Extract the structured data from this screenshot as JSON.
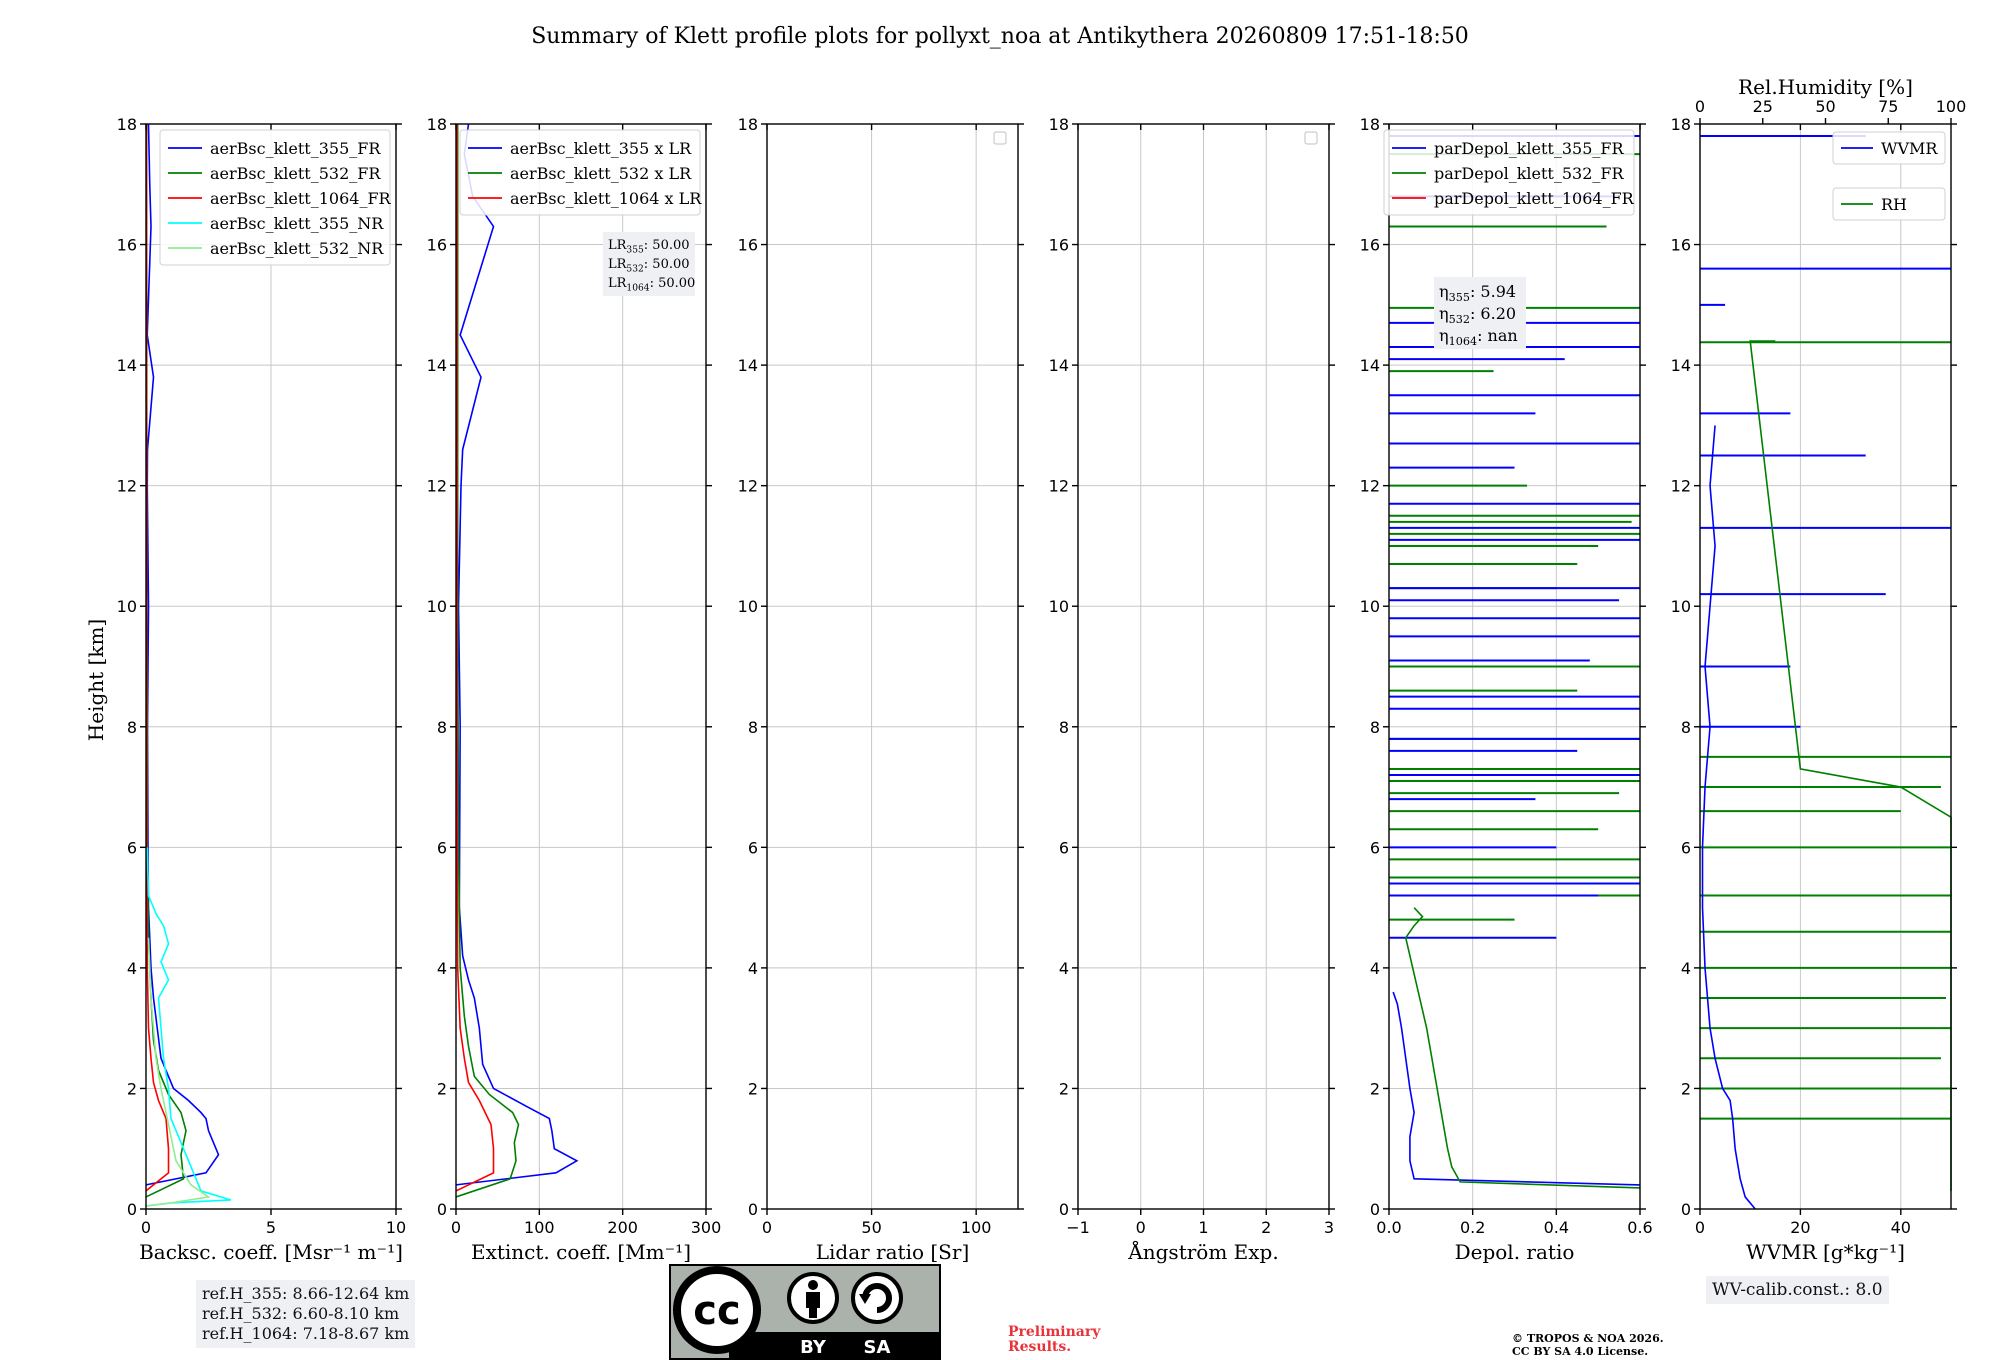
{
  "title": "Summary of Klett profile plots for pollyxt_noa at Antikythera 20260809 17:51-18:50",
  "ylabel": "Height [km]",
  "ref_heights": [
    "ref.H_355: 8.66-12.64 km",
    "ref.H_532: 6.60-8.10 km",
    "ref.H_1064: 7.18-8.67 km"
  ],
  "lidar_ratio_box": [
    {
      "base": "LR",
      "sub": "355",
      "val": ": 50.00"
    },
    {
      "base": "LR",
      "sub": "532",
      "val": ": 50.00"
    },
    {
      "base": "LR",
      "sub": "1064",
      "val": ": 50.00"
    }
  ],
  "eta_box": [
    {
      "base": "η",
      "sub": "355",
      "val": ": 5.94"
    },
    {
      "base": "η",
      "sub": "532",
      "val": ": 6.20"
    },
    {
      "base": "η",
      "sub": "1064",
      "val": ": nan"
    }
  ],
  "wv_calib": "WV-calib.const.: 8.0",
  "preliminary": [
    "Preliminary",
    "Results."
  ],
  "copyright": [
    "© TROPOS & NOA 2026.",
    "CC BY SA 4.0 License."
  ],
  "cc_badge": {
    "main": "cc",
    "by": "BY",
    "sa": "SA",
    "icons": [
      "person-icon",
      "share-alike-icon"
    ]
  },
  "colors": {
    "blue": "#0000ff",
    "green": "#008000",
    "red": "#ff0000",
    "cyan": "#00ffff",
    "lightgreen": "#90ee90",
    "grid": "#c8c8c8"
  },
  "chart_data": [
    {
      "type": "line",
      "xlabel": "Backsc. coeff. [Msr⁻¹ m⁻¹]",
      "xlim": [
        0,
        10
      ],
      "xticks": [
        0,
        5,
        10
      ],
      "ylim": [
        0,
        18
      ],
      "yticks": [
        0,
        2,
        4,
        6,
        8,
        10,
        12,
        14,
        16,
        18
      ],
      "grid": true,
      "legend": "top-right",
      "series": [
        {
          "name": "aerBsc_klett_355_FR",
          "color": "#0000ff",
          "x": [
            0.0,
            2.4,
            2.9,
            2.5,
            2.4,
            2.2,
            1.7,
            1.1,
            0.6,
            0.45,
            0.3,
            0.2,
            0.1,
            0.08,
            0.06,
            0.1,
            0.05,
            0.06,
            0.3,
            0.05,
            0.2,
            0.15,
            0.1
          ],
          "y": [
            0.4,
            0.6,
            0.9,
            1.3,
            1.5,
            1.6,
            1.8,
            2.0,
            2.5,
            3.0,
            3.5,
            4.0,
            5.0,
            6.0,
            8.0,
            10.0,
            12.0,
            12.6,
            13.8,
            14.5,
            16.3,
            17.0,
            18.0
          ]
        },
        {
          "name": "aerBsc_klett_532_FR",
          "color": "#008000",
          "x": [
            0.0,
            1.5,
            1.4,
            1.6,
            1.4,
            0.9,
            0.5,
            0.3,
            0.2,
            0.1,
            0.05,
            0.05,
            0.03,
            0.03,
            0.02
          ],
          "y": [
            0.2,
            0.5,
            0.9,
            1.3,
            1.6,
            1.9,
            2.3,
            2.8,
            3.5,
            4.5,
            6.0,
            8.0,
            10.0,
            14.0,
            18.0
          ]
        },
        {
          "name": "aerBsc_klett_1064_FR",
          "color": "#ff0000",
          "x": [
            0.0,
            0.9,
            0.9,
            0.8,
            0.5,
            0.3,
            0.2,
            0.1,
            0.05,
            0.03,
            0.02,
            0.02
          ],
          "y": [
            0.3,
            0.6,
            1.0,
            1.5,
            1.8,
            2.1,
            2.5,
            3.0,
            4.0,
            6.0,
            10.0,
            18.0
          ]
        },
        {
          "name": "aerBsc_klett_355_NR",
          "color": "#00ffff",
          "x": [
            0.0,
            1.0,
            3.4,
            2.2,
            1.9,
            1.5,
            1.0,
            0.9,
            0.7,
            0.6,
            0.5,
            0.9,
            0.6,
            0.9,
            0.7,
            0.4,
            0.1,
            0.05
          ],
          "y": [
            0.05,
            0.1,
            0.15,
            0.3,
            0.6,
            1.0,
            1.5,
            2.0,
            2.5,
            3.0,
            3.5,
            3.8,
            4.1,
            4.4,
            4.7,
            4.9,
            5.2,
            6.0
          ]
        },
        {
          "name": "aerBsc_klett_532_NR",
          "color": "#90ee90",
          "x": [
            0.0,
            1.0,
            2.5,
            1.8,
            1.2,
            0.9,
            0.6,
            0.4,
            0.3,
            0.2,
            0.1
          ],
          "y": [
            0.05,
            0.1,
            0.2,
            0.4,
            0.8,
            1.4,
            2.0,
            2.5,
            3.0,
            3.5,
            4.5
          ]
        }
      ]
    },
    {
      "type": "line",
      "xlabel": "Extinct. coeff. [Mm⁻¹]",
      "xlim": [
        0,
        300
      ],
      "xticks": [
        0,
        100,
        200,
        300
      ],
      "ylim": [
        0,
        18
      ],
      "yticks": [
        0,
        2,
        4,
        6,
        8,
        10,
        12,
        14,
        16,
        18
      ],
      "grid": true,
      "legend": "top-right",
      "series": [
        {
          "name": "aerBsc_klett_355 x LR",
          "color": "#0000ff",
          "x": [
            0,
            120,
            145,
            118,
            115,
            112,
            85,
            45,
            32,
            28,
            22,
            15,
            8,
            4,
            5,
            3,
            6,
            8,
            30,
            5,
            45,
            20,
            10,
            15
          ],
          "y": [
            0.4,
            0.6,
            0.8,
            1.0,
            1.3,
            1.5,
            1.7,
            2.0,
            2.4,
            3.0,
            3.5,
            3.8,
            4.2,
            5.0,
            8.0,
            10.0,
            12.0,
            12.6,
            13.8,
            14.5,
            16.3,
            16.8,
            17.5,
            18.0
          ]
        },
        {
          "name": "aerBsc_klett_532 x LR",
          "color": "#008000",
          "x": [
            0,
            65,
            72,
            70,
            75,
            68,
            40,
            22,
            15,
            10,
            5,
            3,
            2,
            2
          ],
          "y": [
            0.2,
            0.5,
            0.8,
            1.1,
            1.4,
            1.6,
            1.9,
            2.2,
            2.7,
            3.2,
            4.0,
            6.0,
            10.0,
            18.0
          ]
        },
        {
          "name": "aerBsc_klett_1064 x LR",
          "color": "#ff0000",
          "x": [
            0,
            45,
            45,
            42,
            28,
            15,
            10,
            5,
            2,
            1,
            1
          ],
          "y": [
            0.3,
            0.6,
            1.0,
            1.4,
            1.8,
            2.1,
            2.5,
            3.0,
            4.0,
            8.0,
            18.0
          ]
        }
      ]
    },
    {
      "type": "line",
      "xlabel": "Lidar ratio [Sr]",
      "xlim": [
        0,
        120
      ],
      "xticks": [
        0,
        50,
        100
      ],
      "ylim": [
        0,
        18
      ],
      "yticks": [
        0,
        2,
        4,
        6,
        8,
        10,
        12,
        14,
        16,
        18
      ],
      "grid": true,
      "legend": "top-right",
      "series": []
    },
    {
      "type": "line",
      "xlabel": "Ångström Exp.",
      "xlim": [
        -1,
        3
      ],
      "xticks": [
        -1,
        0,
        1,
        2,
        3
      ],
      "ylim": [
        0,
        18
      ],
      "yticks": [
        0,
        2,
        4,
        6,
        8,
        10,
        12,
        14,
        16,
        18
      ],
      "grid": true,
      "legend": "top-right",
      "series": []
    },
    {
      "type": "line",
      "xlabel": "Depol. ratio",
      "xlim": [
        0,
        0.6
      ],
      "xticks": [
        0.0,
        0.2,
        0.4,
        0.6
      ],
      "xtick_labels": [
        "0.0",
        "0.2",
        "0.4",
        "0.6"
      ],
      "ylim": [
        0,
        18
      ],
      "yticks": [
        0,
        2,
        4,
        6,
        8,
        10,
        12,
        14,
        16,
        18
      ],
      "grid": true,
      "legend": "top-right",
      "series": [
        {
          "name": "parDepol_klett_355_FR",
          "color": "#0000ff",
          "x": [
            0.6,
            0.06,
            0.05,
            0.05,
            0.06,
            0.05,
            0.04,
            0.03,
            0.02,
            0.01
          ],
          "y": [
            0.4,
            0.5,
            0.8,
            1.2,
            1.6,
            2.0,
            2.5,
            3.0,
            3.4,
            3.6
          ]
        },
        {
          "name": "parDepol_klett_532_FR",
          "color": "#008000",
          "x": [
            0.6,
            0.17,
            0.15,
            0.14,
            0.13,
            0.12,
            0.11,
            0.1,
            0.09,
            0.08,
            0.07,
            0.06,
            0.05,
            0.04,
            0.06,
            0.08,
            0.06
          ],
          "y": [
            0.35,
            0.45,
            0.7,
            1.0,
            1.4,
            1.8,
            2.2,
            2.6,
            3.0,
            3.3,
            3.6,
            3.9,
            4.2,
            4.5,
            4.7,
            4.85,
            5.0
          ]
        },
        {
          "name": "parDepol_klett_1064_FR",
          "color": "#ff0000",
          "x": [],
          "y": []
        }
      ],
      "spikes": [
        {
          "color": "#008000",
          "y": [
            17.5,
            16.3,
            14.95,
            13.9,
            12.0,
            11.5,
            11.4,
            11.2,
            11.0,
            10.7,
            10.3,
            9.0,
            8.6,
            7.8,
            7.3,
            7.1,
            6.9,
            6.6,
            6.3,
            5.8,
            5.5,
            5.2,
            4.8
          ],
          "x": [
            0.6,
            0.52,
            0.6,
            0.25,
            0.33,
            0.6,
            0.58,
            0.6,
            0.5,
            0.45,
            0.4,
            0.6,
            0.45,
            0.6,
            0.6,
            0.6,
            0.55,
            0.6,
            0.5,
            0.6,
            0.6,
            0.6,
            0.3
          ]
        },
        {
          "color": "#0000ff",
          "y": [
            17.8,
            16.8,
            14.7,
            14.3,
            14.1,
            13.5,
            13.2,
            12.7,
            12.3,
            11.7,
            11.3,
            11.1,
            10.3,
            10.1,
            9.8,
            9.5,
            9.1,
            8.5,
            8.3,
            7.8,
            7.6,
            7.2,
            6.8,
            6.0,
            5.4,
            5.2,
            4.5
          ],
          "x": [
            0.6,
            0.55,
            0.6,
            0.6,
            0.42,
            0.6,
            0.35,
            0.6,
            0.3,
            0.6,
            0.6,
            0.6,
            0.6,
            0.55,
            0.6,
            0.6,
            0.48,
            0.6,
            0.6,
            0.6,
            0.45,
            0.6,
            0.35,
            0.4,
            0.6,
            0.5,
            0.4
          ]
        }
      ]
    },
    {
      "type": "line",
      "xlabel": "WVMR [g*kg⁻¹]",
      "xlim": [
        0,
        50
      ],
      "xticks": [
        0,
        20,
        40
      ],
      "ylim": [
        0,
        18
      ],
      "yticks": [
        0,
        2,
        4,
        6,
        8,
        10,
        12,
        14,
        16,
        18
      ],
      "top_xlabel": "Rel.Humidity [%]",
      "top_xlim": [
        0,
        100
      ],
      "top_xticks": [
        0,
        25,
        50,
        75,
        100
      ],
      "grid": true,
      "legend": "top-right",
      "series": [
        {
          "name": "WVMR",
          "color": "#0000ff",
          "x": [
            11,
            9,
            8,
            7,
            6.5,
            6,
            4.5,
            3,
            2,
            1.5,
            1,
            0.5,
            0.5,
            1,
            2,
            1,
            2,
            3,
            2,
            3
          ],
          "y": [
            0.0,
            0.2,
            0.5,
            1.0,
            1.5,
            1.8,
            2.0,
            2.5,
            3.0,
            3.5,
            4.0,
            5.0,
            6.0,
            7.0,
            8.0,
            9.0,
            10.0,
            11.0,
            12.0,
            13.0
          ]
        },
        {
          "name": "RH",
          "color": "#008000",
          "x": [
            90,
            92,
            98,
            100,
            96,
            94,
            95,
            100,
            98,
            70,
            60,
            80,
            85,
            90,
            100,
            70,
            40,
            20,
            10,
            15
          ],
          "y": [
            0.3,
            0.8,
            1.2,
            1.6,
            2.0,
            2.4,
            2.8,
            3.2,
            3.6,
            4.0,
            4.4,
            4.8,
            5.2,
            5.6,
            6.0,
            6.5,
            7.0,
            7.3,
            14.4,
            14.4
          ]
        }
      ],
      "spikes": [
        {
          "color": "#0000ff",
          "y": [
            17.8,
            15.6,
            15.0,
            13.2,
            12.5,
            11.3,
            10.2,
            9.0,
            8.0
          ],
          "x": [
            33,
            50,
            5,
            18,
            33,
            50,
            37,
            18,
            20
          ]
        },
        {
          "color": "#008000",
          "y": [
            14.38,
            7.5,
            7.0,
            6.6,
            6.0,
            5.2,
            4.6,
            4.0,
            3.5,
            3.0,
            2.5,
            2.0,
            1.5
          ],
          "x": [
            50,
            50,
            48,
            40,
            50,
            50,
            50,
            50,
            49,
            50,
            48,
            50,
            50
          ]
        }
      ]
    }
  ]
}
